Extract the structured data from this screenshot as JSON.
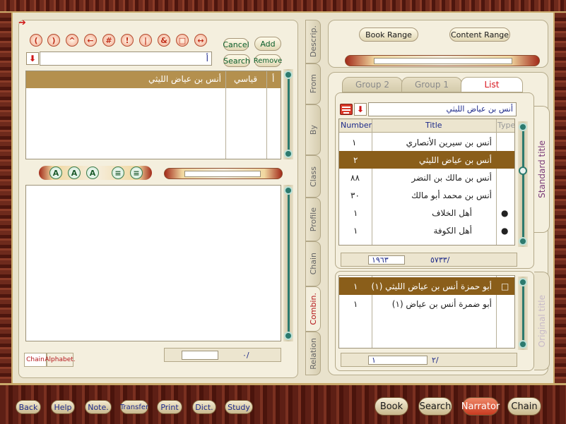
{
  "left": {
    "toolbar_icons": [
      "(",
      ")",
      "^",
      "←",
      "#",
      "!",
      "|",
      "&",
      "□",
      "↔"
    ],
    "cancel_label": "Cancel",
    "add_label": "Add",
    "search_label": "Search",
    "remove_label": "Remove",
    "search_value": "أ",
    "table": {
      "headers": [
        "أ",
        "قياسي",
        "أنس بن عياض الليثي"
      ]
    },
    "lower_toolbar_icons": [
      "A",
      "A",
      "A",
      "≡",
      "≡"
    ],
    "bottom_tabs": [
      "Chain",
      "Alphabet."
    ],
    "counter_value": "٠/"
  },
  "vertical_tabs": [
    {
      "label": "Descrip.",
      "active": false
    },
    {
      "label": "From",
      "active": false
    },
    {
      "label": "By",
      "active": false
    },
    {
      "label": "Class",
      "active": false
    },
    {
      "label": "Profile",
      "active": false
    },
    {
      "label": "Chain",
      "active": false
    },
    {
      "label": "Combin.",
      "active": true
    },
    {
      "label": "Relation",
      "active": false
    }
  ],
  "right": {
    "book_range_label": "Book Range",
    "content_range_label": "Content Range",
    "tabs": [
      {
        "label": "Group 2",
        "active": false
      },
      {
        "label": "Group 1",
        "active": false
      },
      {
        "label": "List",
        "active": true
      }
    ],
    "search_value": "أنس بن عياض الليثي",
    "columns": {
      "number": "Number",
      "title": "Title",
      "type": "Type"
    },
    "rows": [
      {
        "number": "١",
        "title": "أنس بن سيرين الأنصاري",
        "bullet": "",
        "selected": false
      },
      {
        "number": "٢",
        "title": "أنس بن عياض الليثي",
        "bullet": "",
        "selected": true
      },
      {
        "number": "٨٨",
        "title": "أنس بن مالك بن النضر",
        "bullet": "",
        "selected": false
      },
      {
        "number": "٣٠",
        "title": "أنس بن محمد أبو مالك",
        "bullet": "",
        "selected": false
      },
      {
        "number": "١",
        "title": "أهل الخلاف",
        "bullet": "●",
        "selected": false
      },
      {
        "number": "١",
        "title": "أهل الكوفة",
        "bullet": "●",
        "selected": false
      }
    ],
    "status_current": "١٩٦٣",
    "status_total": "٥٧٣٣/",
    "standard_title_label": "Standard title",
    "original_title_label": "Original title",
    "sub_rows": [
      {
        "number": "١",
        "title": "أبو حمزة أنس بن عياض الليثي (١)",
        "selected": true
      },
      {
        "number": "١",
        "title": "أبو ضمرة أنس بن عياض (١)",
        "selected": false
      }
    ],
    "sub_status_current": "١",
    "sub_status_total": "٢/"
  },
  "bottom_left": [
    "Back",
    "Help",
    "Note.",
    "Transfer",
    "Print",
    "Dict.",
    "Study"
  ],
  "bottom_right": [
    {
      "label": "Book",
      "active": false
    },
    {
      "label": "Search",
      "active": false
    },
    {
      "label": "Narrator",
      "active": true
    },
    {
      "label": "Chain",
      "active": false
    }
  ]
}
